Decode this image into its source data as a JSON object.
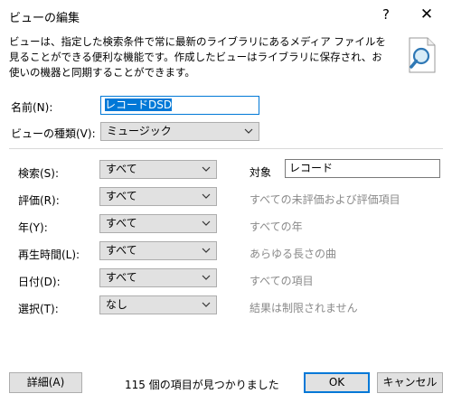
{
  "window": {
    "title": "ビューの編集",
    "help_glyph": "?",
    "close_glyph": "✕"
  },
  "description": "ビューは、指定した検索条件で常に最新のライブラリにあるメディア ファイルを見ることができる便利な機能です。作成したビューはライブラリに保存され、お使いの機器と同期することができます。",
  "name": {
    "label": "名前(N):",
    "value": "レコードDSD"
  },
  "view_type": {
    "label": "ビューの種類(V):",
    "value": "ミュージック"
  },
  "criteria": [
    {
      "label": "検索(S):",
      "value": "すべて",
      "desc": ""
    },
    {
      "label": "評価(R):",
      "value": "すべて",
      "desc": "すべての未評価および評価項目"
    },
    {
      "label": "年(Y):",
      "value": "すべて",
      "desc": "すべての年"
    },
    {
      "label": "再生時間(L):",
      "value": "すべて",
      "desc": "あらゆる長さの曲"
    },
    {
      "label": "日付(D):",
      "value": "すべて",
      "desc": "すべての項目"
    },
    {
      "label": "選択(T):",
      "value": "なし",
      "desc": "結果は制限されません"
    }
  ],
  "target": {
    "label": "対象",
    "value": "レコード"
  },
  "footer": {
    "details_button": "詳細(A)",
    "status": "115 個の項目が見つかりました",
    "ok_button": "OK",
    "cancel_button": "キャンセル"
  },
  "icons": {
    "view_icon": "document-magnifier-icon",
    "dropdown": "chevron-down-icon"
  },
  "colors": {
    "accent": "#0078d7",
    "button_bg": "#e1e1e1",
    "secondary_text": "#8a8a8a"
  }
}
